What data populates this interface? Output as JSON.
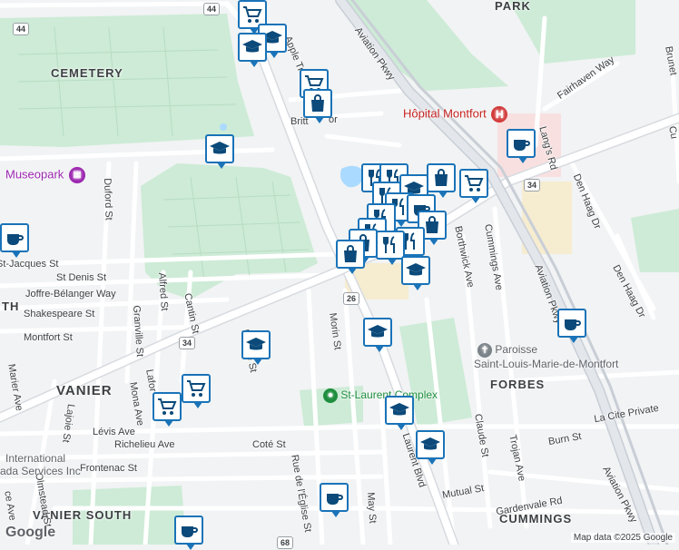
{
  "map": {
    "attribution": "Map data ©2025 Google",
    "logo": "Google",
    "colors": {
      "land": "#f1f3f4",
      "park": "#cdebd6",
      "road": "#ffffff",
      "road_border": "#d7dbe0",
      "highway": "#e3e7ec",
      "marker_border": "#1a73b8",
      "hospital": "#d33b3b",
      "poi_green": "#1e8e3e"
    },
    "areas": [
      {
        "text": "CEMETERY"
      },
      {
        "text": "VANIER"
      },
      {
        "text": "VANIER SOUTH"
      },
      {
        "text": "FORBES"
      },
      {
        "text": "CUMMINGS"
      },
      {
        "text": "PARK"
      },
      {
        "text": "TH"
      }
    ],
    "streets": [
      "Aviation Pkwy",
      "Apple Tree",
      "Britt",
      "or",
      "Fairhaven Way",
      "Lang's Rd",
      "Den Haag Dr",
      "Den Haag Dr",
      "Cummings Ave",
      "Borthwick Ave",
      "Aviation Pkwy",
      "Duford St",
      "St-Jacques St",
      "St Denis St",
      "Joffre-Bélanger Way",
      "Shakespeare St",
      "Montfort St",
      "Granville St",
      "Alfred St",
      "Cantin St",
      "Mona Ave",
      "Lafor",
      "Marier Ave",
      "Lajoie St",
      "Lévis Ave",
      "Richelieu Ave",
      "Coté St",
      "Frontenac St",
      "Rue de l'Église St",
      "l'Église St",
      "Morin St",
      "Laurent Blvd",
      "May St",
      "Mutual St",
      "Claude St",
      "Trojan Ave",
      "Burn St",
      "La Cite Private",
      "Gardenvale Rd",
      "Aviation Pkwy",
      "Olmstead St",
      "Brunet",
      "Cu",
      "ce Ave"
    ],
    "pois": [
      {
        "text": "Hôpital Montfort",
        "icon": "hospital-icon"
      },
      {
        "text": "Museopark",
        "icon": "museum-icon"
      },
      {
        "text": "Paroisse",
        "icon": "church-icon"
      },
      {
        "text": "Saint-Louis-Marie-de-Montfort"
      },
      {
        "text": "St-Laurent Complex",
        "icon": "location-pin-icon"
      },
      {
        "text": "International"
      },
      {
        "text": "ada Services Inc"
      }
    ],
    "shields": [
      "44",
      "44",
      "34",
      "34",
      "26",
      "68"
    ]
  }
}
